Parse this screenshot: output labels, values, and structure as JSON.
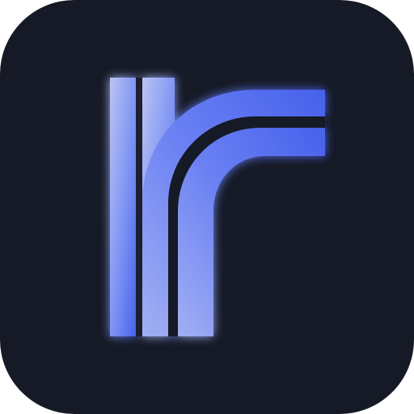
{
  "icon": {
    "name": "app-logo-icon",
    "description_glyph": "r",
    "colors": {
      "background": "#161a26",
      "stroke_light": "#b9c6ff",
      "stroke_mid": "#7d93ff",
      "stroke_dark": "#4a6af7",
      "glow": "#4f6dff"
    }
  }
}
